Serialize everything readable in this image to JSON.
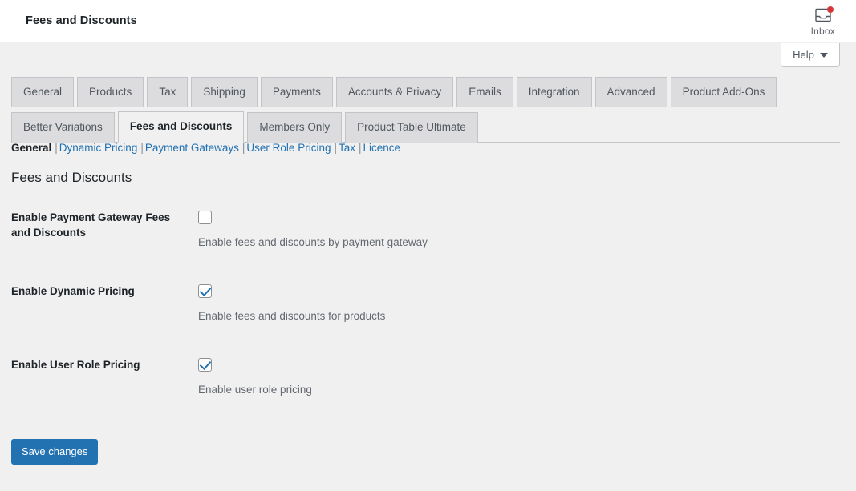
{
  "topbar": {
    "title": "Fees and Discounts",
    "inbox_label": "Inbox",
    "inbox_icon": "inbox-tray-icon",
    "notification_dot_color": "#d63638"
  },
  "help": {
    "label": "Help",
    "caret_icon": "chevron-down-icon"
  },
  "tabs_row1": [
    {
      "label": "General",
      "active": false
    },
    {
      "label": "Products",
      "active": false
    },
    {
      "label": "Tax",
      "active": false
    },
    {
      "label": "Shipping",
      "active": false
    },
    {
      "label": "Payments",
      "active": false
    },
    {
      "label": "Accounts & Privacy",
      "active": false
    },
    {
      "label": "Emails",
      "active": false
    },
    {
      "label": "Integration",
      "active": false
    },
    {
      "label": "Advanced",
      "active": false
    },
    {
      "label": "Product Add-Ons",
      "active": false
    }
  ],
  "tabs_row2": [
    {
      "label": "Better Variations",
      "active": false
    },
    {
      "label": "Fees and Discounts",
      "active": true
    },
    {
      "label": "Members Only",
      "active": false
    },
    {
      "label": "Product Table Ultimate",
      "active": false
    }
  ],
  "subnav": [
    {
      "label": "General",
      "current": true
    },
    {
      "label": "Dynamic Pricing",
      "current": false
    },
    {
      "label": "Payment Gateways",
      "current": false
    },
    {
      "label": "User Role Pricing",
      "current": false
    },
    {
      "label": "Tax",
      "current": false
    },
    {
      "label": "Licence",
      "current": false
    }
  ],
  "subnav_separator": "|",
  "page_heading": "Fees and Discounts",
  "settings": [
    {
      "label": "Enable Payment Gateway Fees and Discounts",
      "checked": false,
      "description": "Enable fees and discounts by payment gateway"
    },
    {
      "label": "Enable Dynamic Pricing",
      "checked": true,
      "description": "Enable fees and discounts for products"
    },
    {
      "label": "Enable User Role Pricing",
      "checked": true,
      "description": "Enable user role pricing"
    }
  ],
  "submit": {
    "label": "Save changes"
  },
  "colors": {
    "accent": "#2271b1",
    "page_bg": "#f0f0f1",
    "topbar_bg": "#ffffff",
    "tab_bg": "#dcdcde",
    "border": "#c3c4c7",
    "text": "#1d2327",
    "muted_text": "#646970"
  }
}
